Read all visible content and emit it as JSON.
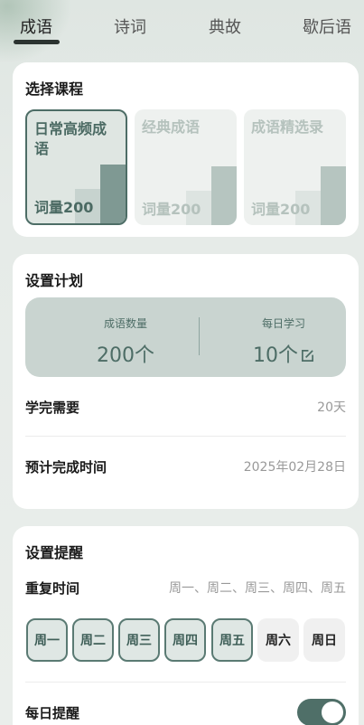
{
  "tabs": [
    {
      "label": "成语",
      "active": true
    },
    {
      "label": "诗词",
      "active": false
    },
    {
      "label": "典故",
      "active": false
    },
    {
      "label": "歇后语",
      "active": false
    }
  ],
  "course_section": {
    "title": "选择课程",
    "courses": [
      {
        "name": "日常高频成语",
        "count": "词量200",
        "selected": true
      },
      {
        "name": "经典成语",
        "count": "词量200",
        "selected": false
      },
      {
        "name": "成语精选录",
        "count": "词量200",
        "selected": false
      }
    ]
  },
  "plan_section": {
    "title": "设置计划",
    "quantity_label": "成语数量",
    "quantity_value": "200个",
    "daily_label": "每日学习",
    "daily_value": "10个",
    "rows": [
      {
        "label": "学完需要",
        "value": "20天"
      },
      {
        "label": "预计完成时间",
        "value": "2025年02月28日"
      }
    ]
  },
  "reminder_section": {
    "title": "设置提醒",
    "repeat_label": "重复时间",
    "repeat_value": "周一、周二、周三、周四、周五",
    "days": [
      {
        "label": "周一",
        "on": true
      },
      {
        "label": "周二",
        "on": true
      },
      {
        "label": "周三",
        "on": true
      },
      {
        "label": "周四",
        "on": true
      },
      {
        "label": "周五",
        "on": true
      },
      {
        "label": "周六",
        "on": false
      },
      {
        "label": "周日",
        "on": false
      }
    ],
    "daily_reminder_label": "每日提醒",
    "daily_reminder_enabled": true
  },
  "colors": {
    "accent": "#4f6f68",
    "accent_light": "#c9d4d0"
  }
}
